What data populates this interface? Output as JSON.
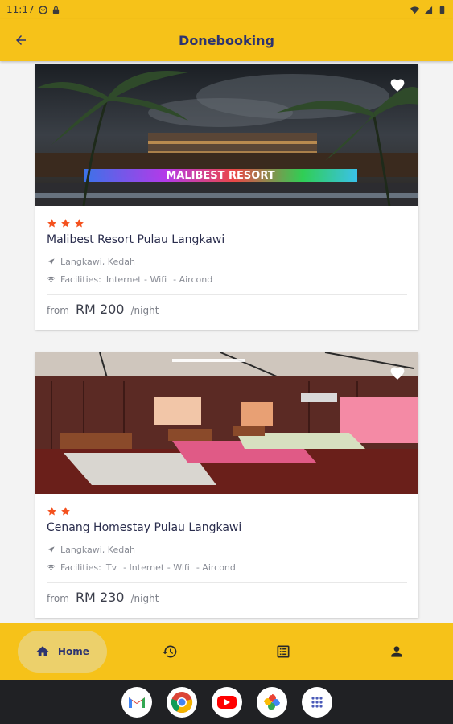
{
  "status_bar": {
    "time": "11:17",
    "icons": [
      "gmail-notification-icon",
      "lock-icon",
      "wifi-icon",
      "signal-icon",
      "battery-icon"
    ]
  },
  "app_bar": {
    "title": "Donebooking",
    "back_icon": "arrow-back-icon"
  },
  "hotels": [
    {
      "name": "Malibest Resort Pulau Langkawi",
      "stars": 3,
      "location": "Langkawi, Kedah",
      "facilities_label": "Facilities:",
      "facilities": [
        "Internet - Wifi",
        "- Aircond"
      ],
      "price_prefix": "from",
      "price": "RM 200",
      "price_unit": "/night",
      "photo_sign": "MALIBEST RESORT",
      "favorited": true
    },
    {
      "name": "Cenang Homestay Pulau Langkawi",
      "stars": 2,
      "location": "Langkawi, Kedah",
      "facilities_label": "Facilities:",
      "facilities": [
        "Tv",
        "- Internet - Wifi",
        "- Aircond"
      ],
      "price_prefix": "from",
      "price": "RM 230",
      "price_unit": "/night",
      "favorited": true
    }
  ],
  "bottom_nav": {
    "items": [
      {
        "label": "Home",
        "icon": "home-icon",
        "active": true
      },
      {
        "label": "",
        "icon": "history-icon",
        "active": false
      },
      {
        "label": "",
        "icon": "list-icon",
        "active": false
      },
      {
        "label": "",
        "icon": "person-icon",
        "active": false
      }
    ]
  },
  "dock": [
    "gmail-icon",
    "chrome-icon",
    "youtube-icon",
    "photos-icon",
    "app-drawer-icon"
  ],
  "colors": {
    "accent": "#f6c219",
    "title": "#2d3470",
    "star": "#f4511e"
  }
}
